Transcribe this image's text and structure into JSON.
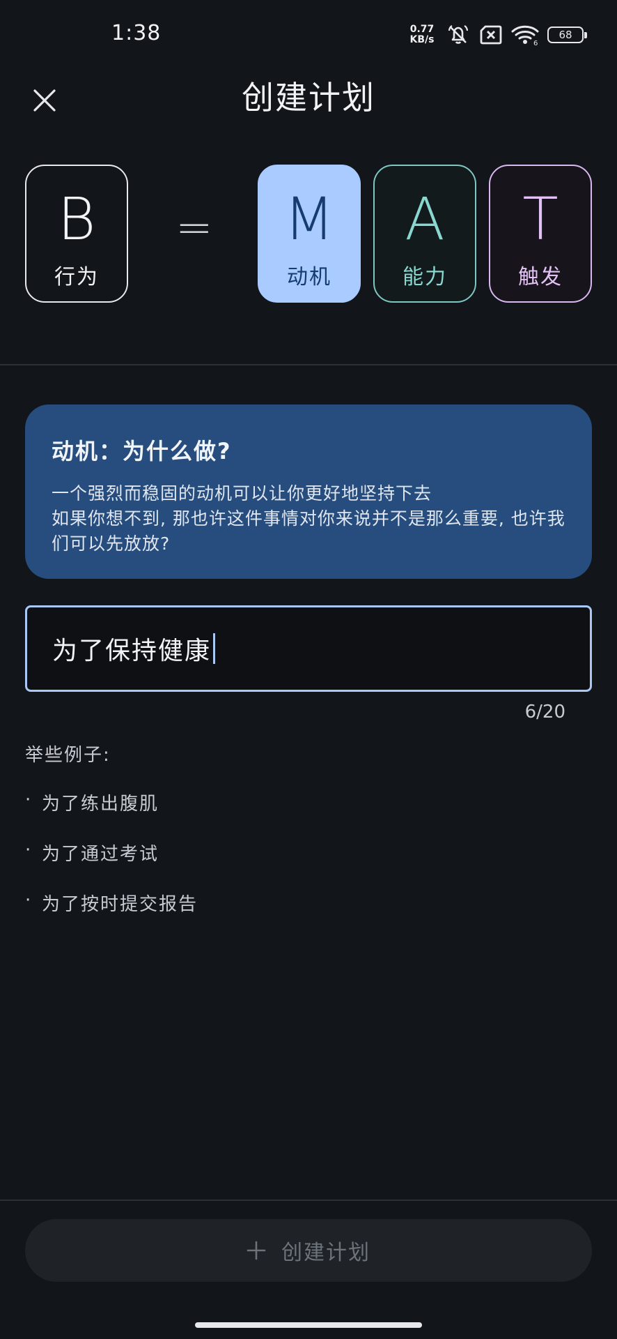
{
  "status_bar": {
    "time": "1:38",
    "net_speed_value": "0.77",
    "net_speed_unit": "KB/s",
    "battery": "68",
    "icons": [
      "network-speed",
      "mute-bell-icon",
      "sim-disabled-icon",
      "wifi-6-icon",
      "battery-icon"
    ]
  },
  "header": {
    "title": "创建计划",
    "close_icon": "close-icon"
  },
  "formula": {
    "behavior": {
      "letter": "B",
      "label": "行为"
    },
    "equals": "=",
    "motivation": {
      "letter": "M",
      "label": "动机"
    },
    "ability": {
      "letter": "A",
      "label": "能力"
    },
    "trigger": {
      "letter": "T",
      "label": "触发"
    }
  },
  "info_card": {
    "title": "动机：为什么做?",
    "line1": "一个强烈而稳固的动机可以让你更好地坚持下去",
    "line2": "如果你想不到, 那也许这件事情对你来说并不是那么重要, 也许我们可以先放放?"
  },
  "input": {
    "value": "为了保持健康",
    "count": "6/20"
  },
  "examples": {
    "label": "举些例子:",
    "bullet": "·",
    "items": [
      "为了练出腹肌",
      "为了通过考试",
      "为了按时提交报告"
    ]
  },
  "create_button": {
    "label": "创建计划",
    "icon": "plus-icon"
  },
  "colors": {
    "background": "#121519",
    "accent_motivation": "#a9cbff",
    "accent_ability": "#8ad6d0",
    "accent_trigger": "#e2c2f5",
    "card_background": "#264d7d"
  }
}
